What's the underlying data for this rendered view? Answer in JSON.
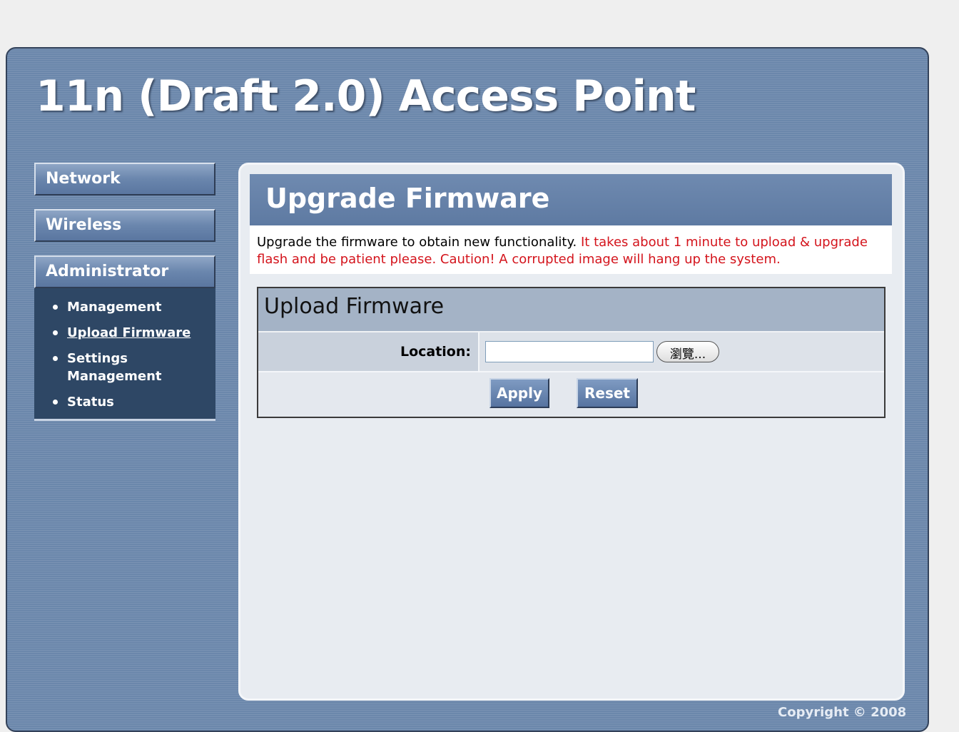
{
  "header": {
    "title": "11n (Draft 2.0) Access Point"
  },
  "nav": {
    "network": "Network",
    "wireless": "Wireless",
    "administrator": "Administrator",
    "sub_items": [
      {
        "label": "Management"
      },
      {
        "label": "Upload Firmware",
        "active": true
      },
      {
        "label": "Settings Management"
      },
      {
        "label": "Status"
      }
    ]
  },
  "page": {
    "title": "Upgrade Firmware",
    "description": "Upgrade the firmware to obtain new functionality.",
    "warning": "It takes about 1 minute to upload & upgrade flash and be patient please. Caution! A corrupted image will hang up the system."
  },
  "panel": {
    "title": "Upload Firmware",
    "location_label": "Location:",
    "location_value": "",
    "browse_label": "瀏覽...",
    "apply_label": "Apply",
    "reset_label": "Reset"
  },
  "footer": {
    "copyright": "Copyright © 2008"
  },
  "colors": {
    "frame_bg": "#6b87ab",
    "submenu_bg": "#2e4765",
    "warning_text": "#d4141c",
    "button_bg": "#6a86ad"
  }
}
